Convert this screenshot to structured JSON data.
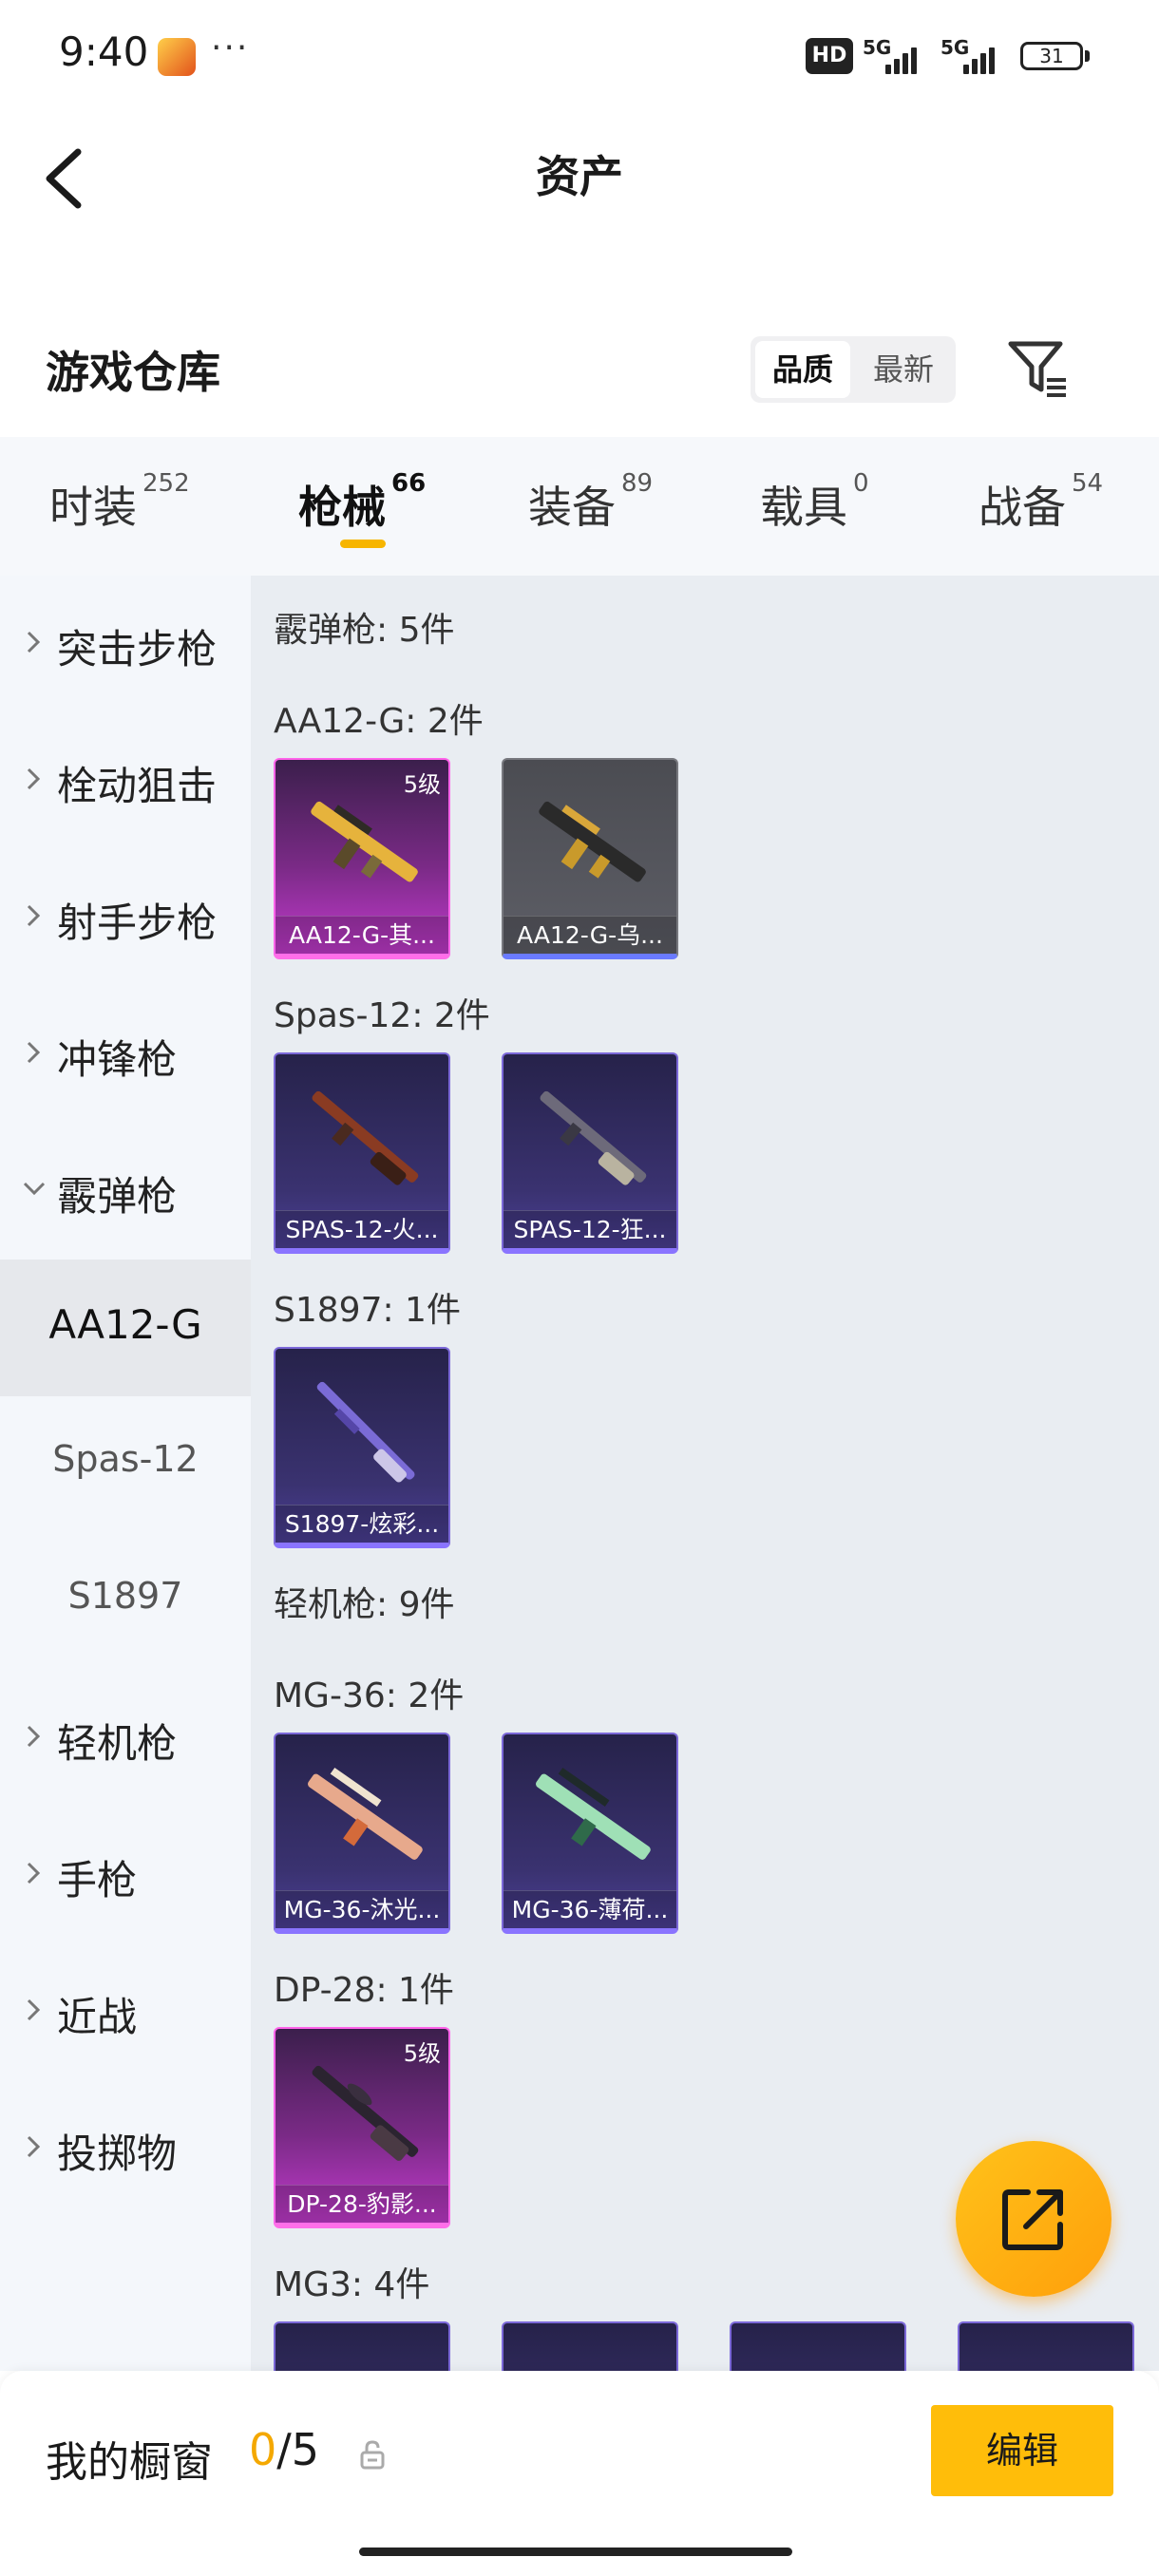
{
  "status_bar": {
    "time": "9:40",
    "more": "···",
    "network_badge": "HD",
    "network_type": "5G",
    "battery": "31"
  },
  "header": {
    "title": "资产",
    "back_icon": "back-arrow-icon"
  },
  "warehouse": {
    "title": "游戏仓库",
    "sort_options": [
      "品质",
      "最新"
    ],
    "sort_active": "品质",
    "filter_icon": "filter-icon"
  },
  "tabs": [
    {
      "label": "时装",
      "count": "252"
    },
    {
      "label": "枪械",
      "count": "66"
    },
    {
      "label": "装备",
      "count": "89"
    },
    {
      "label": "载具",
      "count": "0"
    },
    {
      "label": "战备",
      "count": "54"
    }
  ],
  "active_tab": "枪械",
  "sidebar": {
    "items": [
      {
        "label": "突击步枪",
        "type": "category",
        "expanded": false
      },
      {
        "label": "栓动狙击",
        "type": "category",
        "expanded": false
      },
      {
        "label": "射手步枪",
        "type": "category",
        "expanded": false
      },
      {
        "label": "冲锋枪",
        "type": "category",
        "expanded": false
      },
      {
        "label": "霰弹枪",
        "type": "category",
        "expanded": true
      },
      {
        "label": "AA12-G",
        "type": "sub",
        "selected": true
      },
      {
        "label": "Spas-12",
        "type": "sub",
        "selected": false
      },
      {
        "label": "S1897",
        "type": "sub",
        "selected": false
      },
      {
        "label": "轻机枪",
        "type": "category",
        "expanded": false
      },
      {
        "label": "手枪",
        "type": "category",
        "expanded": false
      },
      {
        "label": "近战",
        "type": "category",
        "expanded": false
      },
      {
        "label": "投掷物",
        "type": "category",
        "expanded": false
      }
    ]
  },
  "content": {
    "groups": [
      {
        "title": "霰弹枪: 5件"
      },
      {
        "title": "AA12-G: 2件",
        "cards": [
          {
            "name": "AA12-G-其...",
            "rarity": "pink",
            "level": "5级"
          },
          {
            "name": "AA12-G-乌...",
            "rarity": "gray"
          }
        ]
      },
      {
        "title": "Spas-12: 2件",
        "cards": [
          {
            "name": "SPAS-12-火...",
            "rarity": "purple"
          },
          {
            "name": "SPAS-12-狂...",
            "rarity": "purple"
          }
        ]
      },
      {
        "title": "S1897: 1件",
        "cards": [
          {
            "name": "S1897-炫彩...",
            "rarity": "purple"
          }
        ]
      },
      {
        "title": "轻机枪: 9件"
      },
      {
        "title": "MG-36: 2件",
        "cards": [
          {
            "name": "MG-36-沐光...",
            "rarity": "purple"
          },
          {
            "name": "MG-36-薄荷...",
            "rarity": "purple"
          }
        ]
      },
      {
        "title": "DP-28: 1件",
        "cards": [
          {
            "name": "DP-28-豹影...",
            "rarity": "pink",
            "level": "5级"
          }
        ]
      },
      {
        "title": "MG3: 4件"
      }
    ]
  },
  "fab": {
    "icon": "share-icon"
  },
  "bottom_bar": {
    "label": "我的橱窗",
    "current": "0",
    "total": "/5",
    "lock_icon": "lock-icon",
    "edit_label": "编辑"
  },
  "colors": {
    "accent": "#FFBD0A",
    "count_accent": "#F4A800",
    "rarity_pink": "#FF63EA",
    "rarity_purple": "#7B68D8",
    "rarity_gray": "#5D5E66"
  }
}
